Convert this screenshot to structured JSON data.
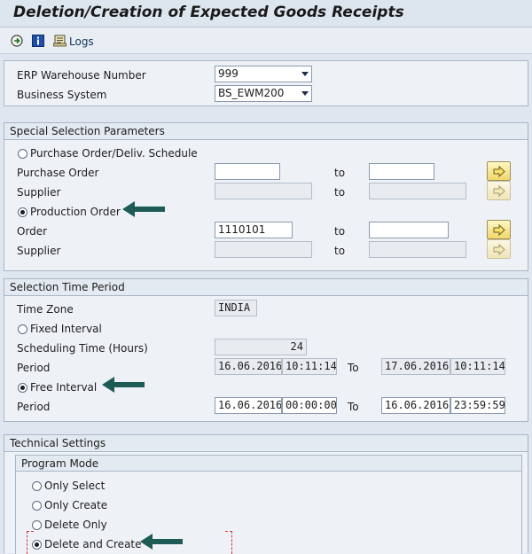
{
  "window": {
    "title": "Deletion/Creation of Expected Goods Receipts"
  },
  "toolbar": {
    "logs_label": "Logs"
  },
  "general": {
    "warehouse_label": "ERP Warehouse Number",
    "warehouse_value": "999",
    "system_label": "Business System",
    "system_value": "BS_EWM200"
  },
  "special": {
    "header": "Special Selection Parameters",
    "po_radio_label": "Purchase Order/Deliv. Schedule",
    "po_label": "Purchase Order",
    "po_from": "",
    "po_to": "",
    "supplier_label": "Supplier",
    "to_label": "to",
    "prod_radio_label": "Production Order",
    "order_label": "Order",
    "order_from": "1110101",
    "order_to": "",
    "supplier2_label": "Supplier",
    "po_selected": false,
    "prod_selected": true
  },
  "time": {
    "header": "Selection Time Period",
    "tz_label": "Time Zone",
    "tz_value": "INDIA",
    "fixed_label": "Fixed Interval",
    "sched_label": "Scheduling Time (Hours)",
    "sched_value": "24",
    "period_label": "Period",
    "to_label": "To",
    "fixed_from_date": "16.06.2016",
    "fixed_from_time": "10:11:14",
    "fixed_to_date": "17.06.2016",
    "fixed_to_time": "10:11:14",
    "free_label": "Free Interval",
    "free_period_label": "Period",
    "free_from_date": "16.06.2016",
    "free_from_time": "00:00:00",
    "free_to_date": "16.06.2016",
    "free_to_time": "23:59:59",
    "fixed_selected": false,
    "free_selected": true
  },
  "technical": {
    "header": "Technical Settings",
    "mode_header": "Program Mode",
    "modes": [
      {
        "label": "Only Select",
        "selected": false
      },
      {
        "label": "Only Create",
        "selected": false
      },
      {
        "label": "Delete Only",
        "selected": false
      },
      {
        "label": "Delete and Create",
        "selected": true
      }
    ]
  },
  "colors": {
    "annotation_arrow": "#1e5b57",
    "multi_button": "#f0d76a"
  }
}
